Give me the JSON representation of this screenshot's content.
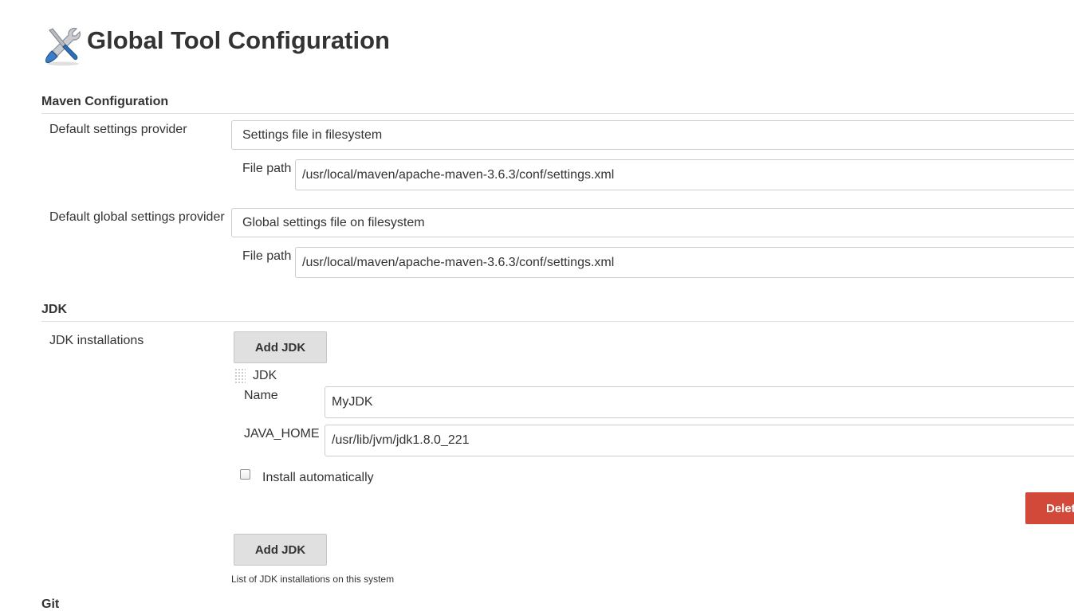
{
  "page": {
    "title": "Global Tool Configuration",
    "icon": "tools-icon"
  },
  "maven": {
    "section_title": "Maven Configuration",
    "settings_provider_label": "Default settings provider",
    "settings_provider_value": "Settings file in filesystem",
    "settings_file_path_label": "File path",
    "settings_file_path_value": "/usr/local/maven/apache-maven-3.6.3/conf/settings.xml",
    "global_settings_provider_label": "Default global settings provider",
    "global_settings_provider_value": "Global settings file on filesystem",
    "global_file_path_label": "File path",
    "global_file_path_value": "/usr/local/maven/apache-maven-3.6.3/conf/settings.xml"
  },
  "jdk": {
    "section_title": "JDK",
    "installations_label": "JDK installations",
    "add_button_label": "Add JDK",
    "entry_title": "JDK",
    "name_label": "Name",
    "name_value": "MyJDK",
    "java_home_label": "JAVA_HOME",
    "java_home_value": "/usr/lib/jvm/jdk1.8.0_221",
    "install_auto_label": "Install automatically",
    "install_auto_checked": false,
    "delete_button_label": "Delete",
    "help_text": "List of JDK installations on this system"
  },
  "git": {
    "section_title": "Git"
  },
  "colors": {
    "delete_button": "#d24939",
    "add_button_bg": "#e0e0e0",
    "text": "#333333"
  }
}
